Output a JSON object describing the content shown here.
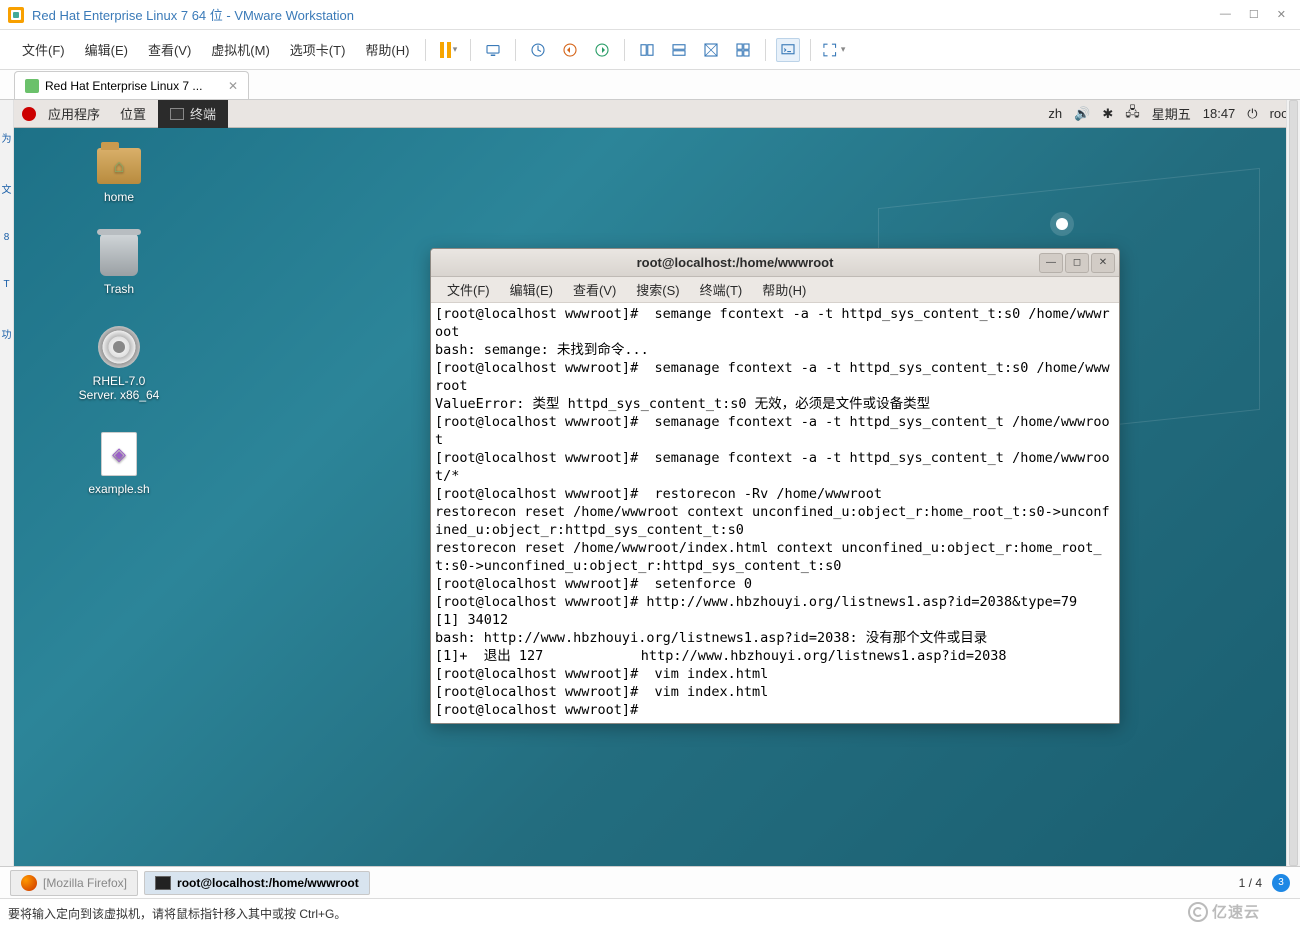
{
  "vmware": {
    "title": "Red Hat Enterprise Linux 7 64 位 - VMware Workstation",
    "menu": {
      "file": "文件(F)",
      "edit": "编辑(E)",
      "view": "查看(V)",
      "vm": "虚拟机(M)",
      "tabs": "选项卡(T)",
      "help": "帮助(H)"
    },
    "tab_label": "Red Hat Enterprise Linux 7 ..."
  },
  "gnome": {
    "apps": "应用程序",
    "places": "位置",
    "terminal_tab": "终端",
    "lang": "zh",
    "weekday": "星期五",
    "time": "18:47",
    "user": "root"
  },
  "desktop": {
    "home": "home",
    "trash": "Trash",
    "disc": "RHEL-7.0 Server. x86_64",
    "example": "example.sh"
  },
  "terminal": {
    "title": "root@localhost:/home/wwwroot",
    "menu": {
      "file": "文件(F)",
      "edit": "编辑(E)",
      "view": "查看(V)",
      "search": "搜索(S)",
      "terminal": "终端(T)",
      "help": "帮助(H)"
    },
    "lines": [
      "[root@localhost wwwroot]#  semange fcontext -a -t httpd_sys_content_t:s0 /home/wwwroot",
      "bash: semange: 未找到命令...",
      "[root@localhost wwwroot]#  semanage fcontext -a -t httpd_sys_content_t:s0 /home/wwwroot",
      "ValueError: 类型 httpd_sys_content_t:s0 无效，必须是文件或设备类型",
      "[root@localhost wwwroot]#  semanage fcontext -a -t httpd_sys_content_t /home/wwwroot",
      "[root@localhost wwwroot]#  semanage fcontext -a -t httpd_sys_content_t /home/wwwroot/*",
      "[root@localhost wwwroot]#  restorecon -Rv /home/wwwroot",
      "restorecon reset /home/wwwroot context unconfined_u:object_r:home_root_t:s0->unconfined_u:object_r:httpd_sys_content_t:s0",
      "restorecon reset /home/wwwroot/index.html context unconfined_u:object_r:home_root_t:s0->unconfined_u:object_r:httpd_sys_content_t:s0",
      "[root@localhost wwwroot]#  setenforce 0",
      "[root@localhost wwwroot]# http://www.hbzhouyi.org/listnews1.asp?id=2038&type=79",
      "[1] 34012",
      "bash: http://www.hbzhouyi.org/listnews1.asp?id=2038: 没有那个文件或目录",
      "[1]+  退出 127            http://www.hbzhouyi.org/listnews1.asp?id=2038",
      "[root@localhost wwwroot]#  vim index.html",
      "[root@localhost wwwroot]#  vim index.html",
      "[root@localhost wwwroot]# "
    ]
  },
  "host_bottom": {
    "firefox": "[Mozilla Firefox]",
    "term": "root@localhost:/home/wwwroot",
    "page": "1 / 4",
    "badge": "3"
  },
  "status_hint": "要将输入定向到该虚拟机，请将鼠标指针移入其中或按 Ctrl+G。",
  "watermark": "亿速云"
}
